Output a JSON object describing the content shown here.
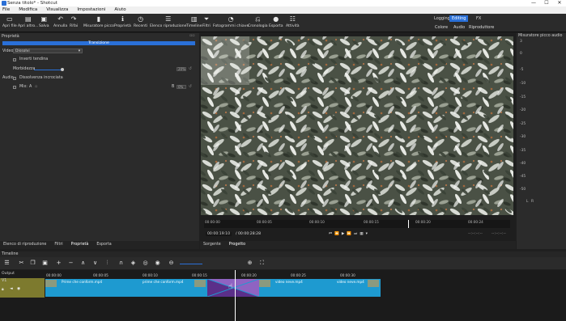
{
  "window": {
    "title": "Senza titolo* - Shotcut",
    "minimize": "—",
    "maximize": "☐",
    "close": "✕"
  },
  "menu": [
    "File",
    "Modifica",
    "Visualizza",
    "Impostazioni",
    "Aiuto"
  ],
  "toolbar": {
    "items": [
      {
        "label": "Apri file",
        "icon": "folder-icon",
        "glyph": "📁"
      },
      {
        "label": "Apri altro...",
        "icon": "open-other-icon",
        "glyph": "▤"
      },
      {
        "label": "Salva",
        "icon": "save-icon",
        "glyph": "💾"
      },
      {
        "label": "Annulla",
        "icon": "undo-icon",
        "glyph": "↶"
      },
      {
        "label": "Rifai",
        "icon": "redo-icon",
        "glyph": "↷"
      },
      {
        "label": "Misuratore picco",
        "icon": "peak-meter-icon",
        "glyph": "▮"
      },
      {
        "label": "Proprietà",
        "icon": "info-icon",
        "glyph": "ℹ"
      },
      {
        "label": "Recenti",
        "icon": "clock-icon",
        "glyph": "◷"
      },
      {
        "label": "Elenco riproduzione",
        "icon": "list-icon",
        "glyph": "☰"
      },
      {
        "label": "Timeline",
        "icon": "timeline-icon",
        "glyph": "▥"
      },
      {
        "label": "Filtri",
        "icon": "filter-icon",
        "glyph": "⏷"
      },
      {
        "label": "Fotogrammi chiave",
        "icon": "stopwatch-icon",
        "glyph": "⏱"
      },
      {
        "label": "Cronologia",
        "icon": "history-icon",
        "glyph": "⎌"
      },
      {
        "label": "Esporta",
        "icon": "export-icon",
        "glyph": "●"
      },
      {
        "label": "Attività",
        "icon": "jobs-icon",
        "glyph": "☷"
      }
    ],
    "layouts_top": [
      "Logging",
      "Editing",
      "FX"
    ],
    "layouts_bottom": [
      "Colore",
      "Audio",
      "Riproduttore"
    ]
  },
  "properties": {
    "title": "Proprietà",
    "transition_label": "Transizione",
    "video_label": "Video",
    "video_value": "Dissolvi",
    "invert_label": "Inverti tendina",
    "softness_label": "Morbidezza",
    "softness_value": "20%",
    "audio_label": "Audio",
    "audio_option": "Dissolvenza incrociata",
    "mix_label": "Mix:",
    "mix_a": "A",
    "mix_b": "B",
    "mix_value": "0%"
  },
  "viewer": {
    "ticks": [
      "00:00:00",
      "00:00:05",
      "00:00:10",
      "00:00:15",
      "00:00:20",
      "00:00:24"
    ],
    "timecode": "00:00:19:10",
    "duration": "/ 00:00:28:28",
    "right_tc1": "--:--:--:--",
    "right_tc2": "--:--:--:--"
  },
  "tabs_left": [
    "Elenco di riproduzione",
    "Filtri",
    "Proprietà",
    "Esporta"
  ],
  "tabs_mid": [
    "Sorgente",
    "Progetto"
  ],
  "audio_meter": {
    "title": "Misuratore picco audio",
    "scale": [
      "3",
      "0",
      "-5",
      "-10",
      "-15",
      "-20",
      "-25",
      "-30",
      "-35",
      "-40",
      "-45",
      "-50"
    ],
    "channels": [
      "L",
      "R"
    ]
  },
  "timeline": {
    "title": "Timeline",
    "track_label": "Output",
    "track_name": "V1",
    "ruler": [
      "00:00:00",
      "00:00:05",
      "00:00:10",
      "00:00:15",
      "00:00:20",
      "00:00:25",
      "00:00:30"
    ],
    "clip_a_labels": [
      "Prime che conform.mp4",
      "prime che conform.mp4"
    ],
    "clip_b_labels": [
      "video neve.mp4",
      "video neve.mp4"
    ]
  },
  "colors": {
    "accent": "#2a70d8",
    "clip": "#1e9ad0",
    "transition": "#7a4ba8",
    "track_head": "#7d7a2e"
  }
}
